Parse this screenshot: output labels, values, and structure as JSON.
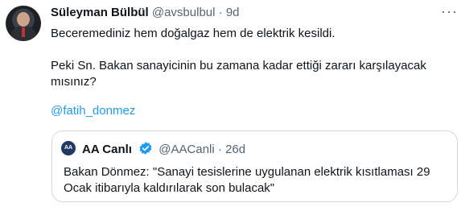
{
  "author": {
    "name": "Süleyman Bülbül",
    "handle": "@avsbulbul",
    "separator": "·",
    "time": "9d",
    "more": "···"
  },
  "tweet": {
    "line1": "Beceremediniz hem doğalgaz hem de elektrik kesildi.",
    "line2": "Peki Sn. Bakan sanayicinin bu zamana kadar ettiği zararı karşılayacak",
    "line3": "mısınız?",
    "mention": "@fatih_donmez"
  },
  "quoted": {
    "avatar_text": "AA",
    "name": "AA Canlı",
    "verified_color": "#1d9bf0",
    "handle": "@AACanli",
    "separator": "·",
    "time": "26d",
    "line1": "Bakan Dönmez: \"Sanayi tesislerine uygulanan elektrik kısıtlaması 29",
    "line2": "Ocak itibarıyla kaldırılarak son bulacak\""
  }
}
